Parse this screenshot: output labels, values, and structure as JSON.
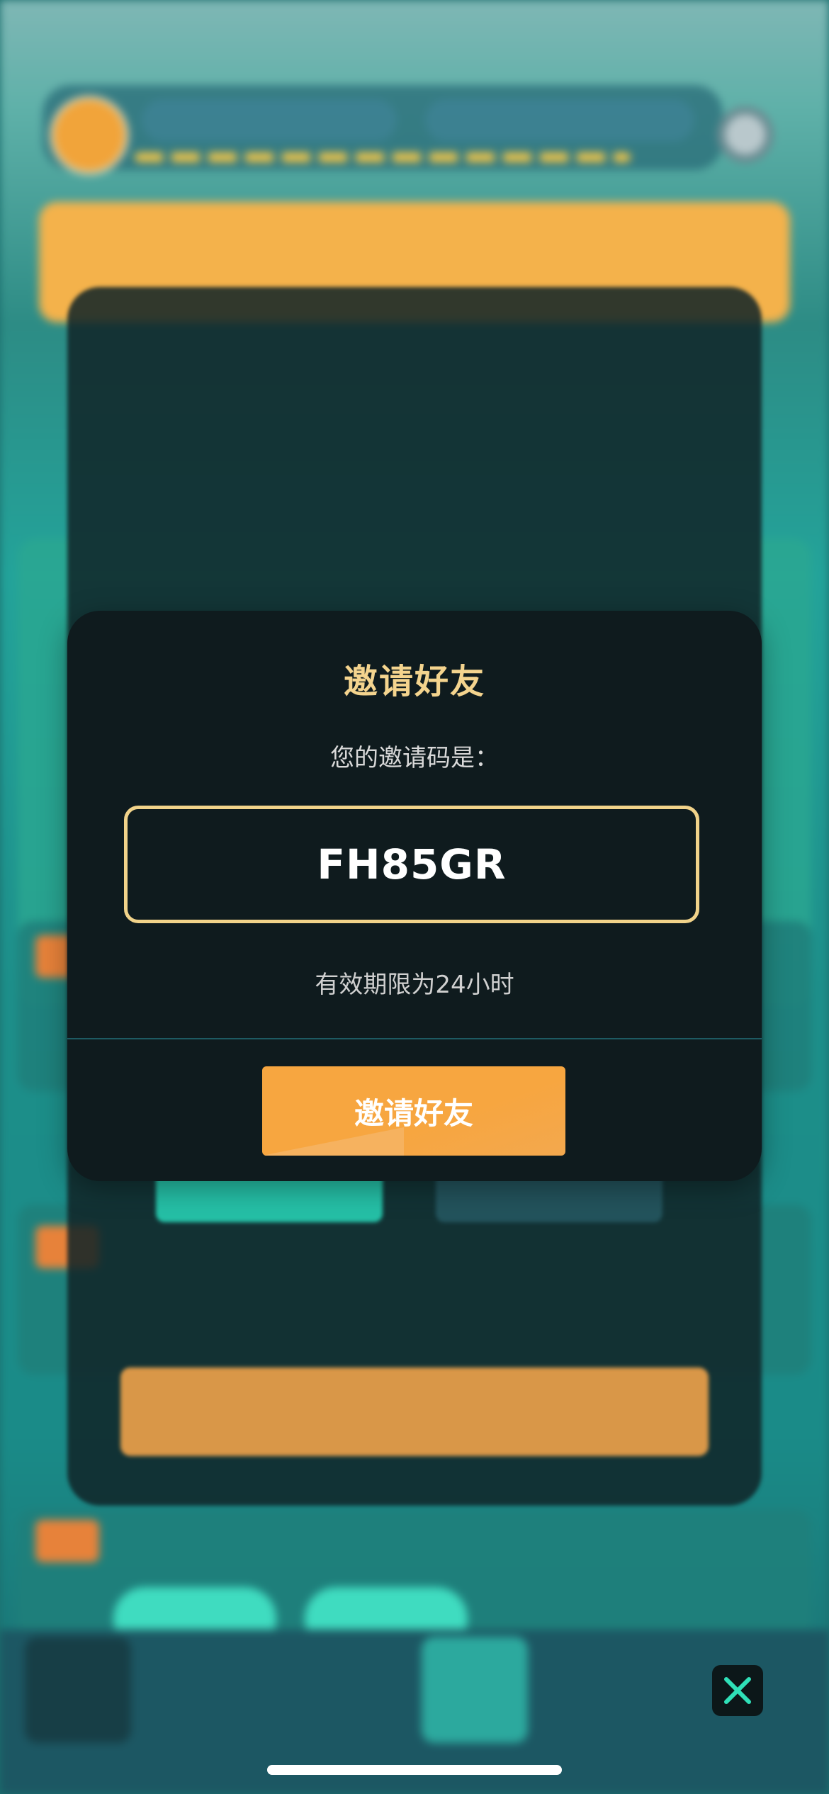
{
  "dialog": {
    "title": "邀请好友",
    "subtitle": "您的邀请码是：",
    "code": "FH85GR",
    "validity": "有效期限为24小时",
    "button_label": "邀请好友"
  },
  "colors": {
    "title": "#f4d48e",
    "code_border": "#f1d38a",
    "button": "#f7a640",
    "dialog_bg": "#0f1b1e",
    "close_icon": "#2fe0b8"
  },
  "icons": {
    "close": "close-icon"
  }
}
